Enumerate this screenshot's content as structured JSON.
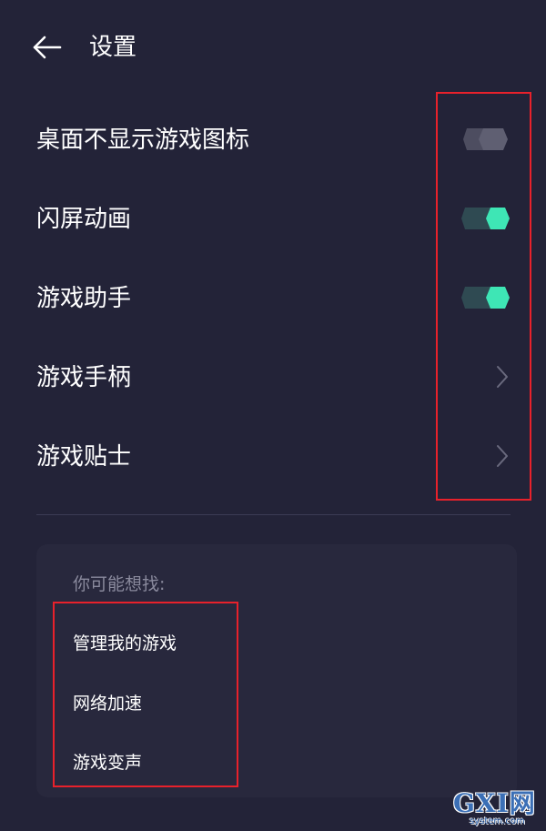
{
  "header": {
    "title": "设置",
    "back_icon": "arrow-left-icon"
  },
  "settings": {
    "items": [
      {
        "label": "桌面不显示游戏图标",
        "control": "toggle",
        "checked": false
      },
      {
        "label": "闪屏动画",
        "control": "toggle",
        "checked": true
      },
      {
        "label": "游戏助手",
        "control": "toggle",
        "checked": true
      },
      {
        "label": "游戏手柄",
        "control": "chevron",
        "icon": "chevron-right-icon"
      },
      {
        "label": "游戏贴士",
        "control": "chevron",
        "icon": "chevron-right-icon"
      }
    ]
  },
  "suggestions": {
    "title": "你可能想找:",
    "links": [
      {
        "label": "管理我的游戏"
      },
      {
        "label": "网络加速"
      },
      {
        "label": "游戏变声"
      }
    ]
  },
  "watermark": {
    "text": "GXI网",
    "subtext": "system.com"
  },
  "colors": {
    "background": "#232338",
    "card": "#28283d",
    "toggle_on_knob": "#3ee6b5",
    "toggle_on_track": "#2f4a52",
    "toggle_off": "#5a5a6d",
    "annotation_red": "#e8212b"
  }
}
